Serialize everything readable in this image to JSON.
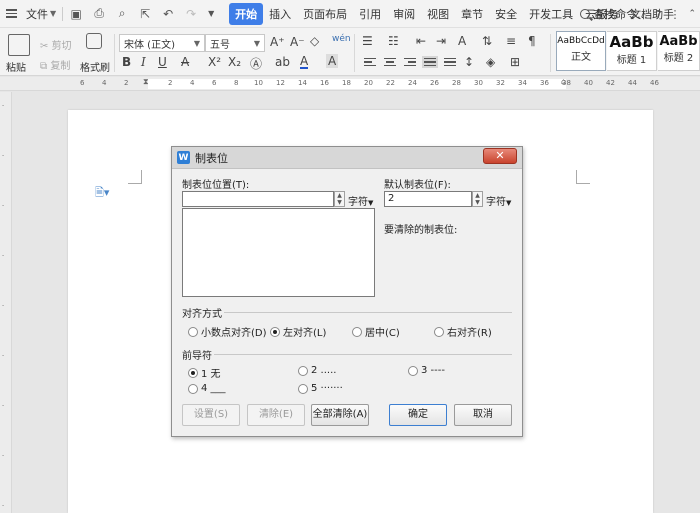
{
  "menubar": {
    "file_label": "文件",
    "tabs": [
      "开始",
      "插入",
      "页面布局",
      "引用",
      "审阅",
      "视图",
      "章节",
      "安全",
      "开发工具",
      "云服务",
      "文档助手"
    ],
    "active_tab": "开始",
    "search_label": "查找命令...",
    "help_label": "?",
    "more_label": "⋮"
  },
  "ribbon": {
    "paste": "粘贴",
    "cut": "剪切",
    "copy": "复制",
    "format_painter": "格式刷",
    "font_name": "宋体 (正文)",
    "font_size": "五号",
    "styles": [
      {
        "sample": "AaBbCcDd",
        "label": "正文"
      },
      {
        "sample": "AaBb",
        "label": "标题 1"
      },
      {
        "sample": "AaBb",
        "label": "标题 2"
      }
    ]
  },
  "ruler": {
    "numbers": [
      "6",
      "4",
      "2",
      "2",
      "4",
      "6",
      "8",
      "10",
      "12",
      "14",
      "16",
      "18",
      "20",
      "22",
      "24",
      "26",
      "28",
      "30",
      "32",
      "34",
      "36",
      "38",
      "40",
      "42",
      "44",
      "46"
    ]
  },
  "dialog": {
    "title": "制表位",
    "close_label": "✕",
    "tab_position_label": "制表位位置(T):",
    "tab_position_value": "",
    "tab_position_unit": "字符",
    "default_tab_label": "默认制表位(F):",
    "default_tab_value": "2",
    "default_tab_unit": "字符",
    "clear_label": "要清除的制表位:",
    "alignment_label": "对齐方式",
    "alignments": [
      {
        "label": "小数点对齐(D)",
        "checked": false
      },
      {
        "label": "左对齐(L)",
        "checked": true
      },
      {
        "label": "居中(C)",
        "checked": false
      },
      {
        "label": "右对齐(R)",
        "checked": false
      }
    ],
    "leader_label": "前导符",
    "leaders": [
      {
        "label": "1 无",
        "checked": true
      },
      {
        "label": "2 .....",
        "checked": false
      },
      {
        "label": "3 ----",
        "checked": false
      },
      {
        "label": "4 ___",
        "checked": false
      },
      {
        "label": "5 ·······",
        "checked": false
      }
    ],
    "buttons": {
      "set": "设置(S)",
      "clear": "清除(E)",
      "clear_all": "全部清除(A)",
      "ok": "确定",
      "cancel": "取消"
    }
  }
}
